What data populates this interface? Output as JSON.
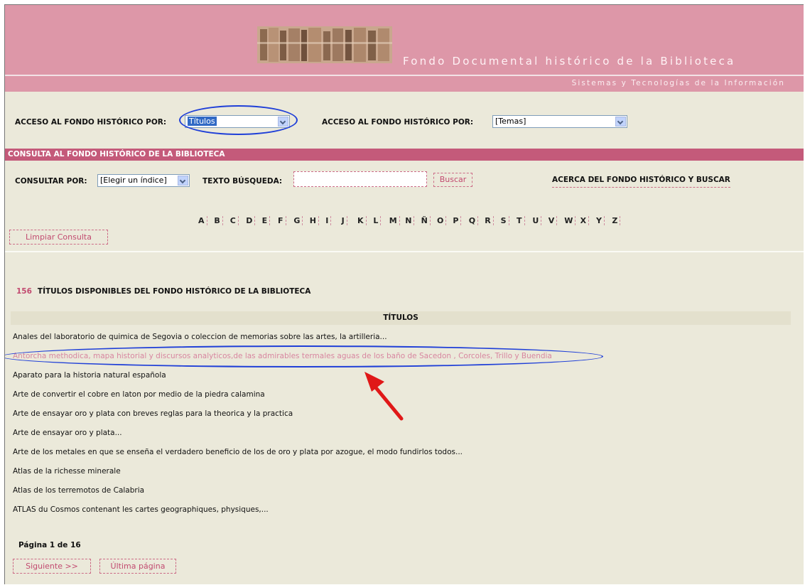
{
  "header": {
    "title": "Fondo Documental histórico de la Biblioteca",
    "subtitle": "Sistemas y Tecnologías de la Información"
  },
  "access1": {
    "label": "ACCESO AL FONDO HISTÓRICO POR:",
    "value": "Títulos"
  },
  "access2": {
    "label": "ACCESO AL FONDO HISTÓRICO POR:",
    "value": "[Temas]"
  },
  "consulta": {
    "bar_title": "CONSULTA AL FONDO HISTÓRICO DE LA BIBLIOTECA",
    "consultar_label": "CONSULTAR POR:",
    "consultar_value": "[Elegir un índice]",
    "texto_label": "TEXTO BÚSQUEDA:",
    "texto_value": "",
    "buscar": "Buscar",
    "acerca": "ACERCA DEL FONDO HISTÓRICO Y BUSCAR",
    "limpiar": "Limpiar Consulta"
  },
  "letters": [
    "A",
    "B",
    "C",
    "D",
    "E",
    "F",
    "G",
    "H",
    "I",
    "J",
    "K",
    "L",
    "M",
    "N",
    "Ñ",
    "O",
    "P",
    "Q",
    "R",
    "S",
    "T",
    "U",
    "V",
    "W",
    "X",
    "Y",
    "Z"
  ],
  "results": {
    "count": "156",
    "caption": "TÍTULOS DISPONIBLES DEL FONDO HISTÓRICO DE LA BIBLIOTECA",
    "column_header": "TÍTULOS",
    "titles": [
      "Anales del laboratorio de quimica de Segovia o coleccion de memorias sobre las artes, la artilleria...",
      "Antorcha methodica, mapa historial y discursos analyticos,de las admirables termales aguas de los baño de Sacedon , Corcoles, Trillo y Buendia",
      "Aparato para la historia natural española",
      "Arte de convertir el cobre en laton por medio de la piedra calamina",
      "Arte de ensayar oro y plata con breves reglas para la theorica y la practica",
      "Arte de ensayar oro y plata...",
      "Arte de los metales en que se enseña el verdadero beneficio de los de oro y plata por azogue, el modo fundirlos todos...",
      "Atlas de la richesse minerale",
      "Atlas de los terremotos de Calabria",
      "ATLAS du Cosmos contenant les cartes geographiques, physiques,..."
    ]
  },
  "pagination": {
    "page_info": "Página 1 de 16",
    "next": "Siguiente >>",
    "last": "Última página"
  }
}
